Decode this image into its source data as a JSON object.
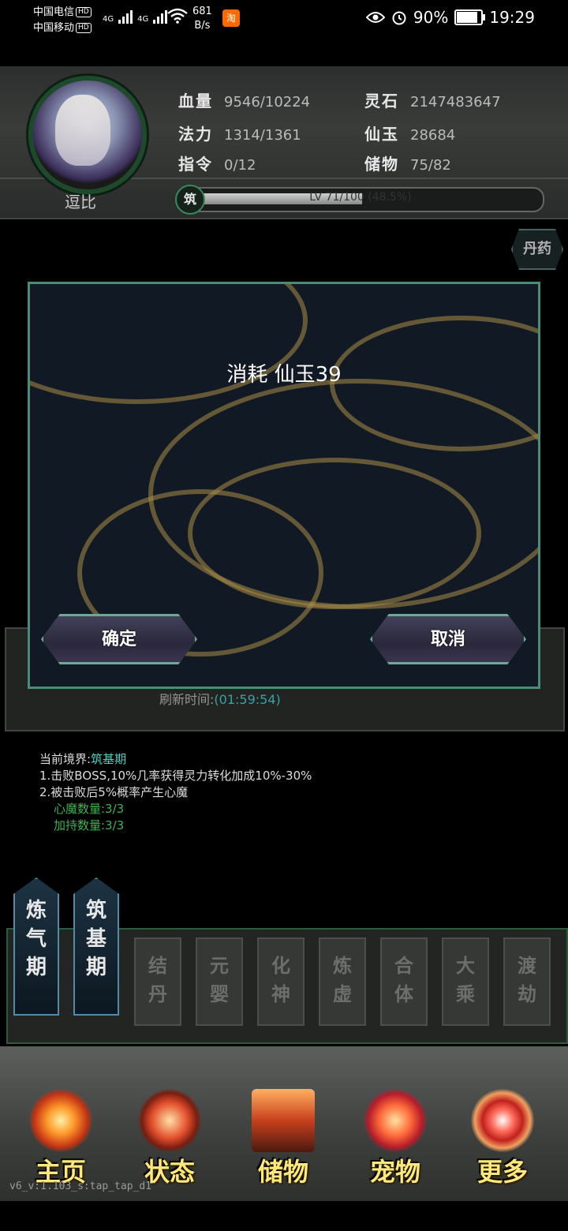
{
  "status_bar": {
    "carrier1": "中国电信",
    "carrier2": "中国移动",
    "hd": "HD",
    "net1": "4G",
    "net2": "4G",
    "speed_value": "681",
    "speed_unit": "B/s",
    "app_badge": "淘",
    "battery": "90%",
    "battery_level": 0.9,
    "time": "19:29"
  },
  "player": {
    "name": "逗比",
    "stats": [
      {
        "label": "血量",
        "value": "9546/10224"
      },
      {
        "label": "灵石",
        "value": "2147483647"
      },
      {
        "label": "法力",
        "value": "1314/1361"
      },
      {
        "label": "仙玉",
        "value": "28684"
      },
      {
        "label": "指令",
        "value": "0/12"
      },
      {
        "label": "储物",
        "value": "75/82"
      }
    ],
    "realm_badge": "筑",
    "level_text": "LV 71/100 (48.5%)",
    "level_fraction": 0.485
  },
  "side_button": "丹药",
  "background": {
    "refresh_label": "刷新时间:",
    "refresh_time": "(01:59:54)",
    "realm_label": "当前境界:",
    "realm_value": "筑基期",
    "line1": "1.击败BOSS,10%几率获得灵力转化加成10%-30%",
    "line2": "2.被击败后5%概率产生心魔",
    "line3": "心魔数量:3/3",
    "line4": "加持数量:3/3"
  },
  "realm_tabs": {
    "active": [
      "炼气期",
      "筑基期"
    ],
    "locked": [
      "结丹",
      "元婴",
      "化神",
      "炼虚",
      "合体",
      "大乘",
      "渡劫"
    ]
  },
  "nav": [
    {
      "label": "主页",
      "icon": "home-icon"
    },
    {
      "label": "状态",
      "icon": "status-icon"
    },
    {
      "label": "储物",
      "icon": "storage-icon"
    },
    {
      "label": "宠物",
      "icon": "pet-icon"
    },
    {
      "label": "更多",
      "icon": "more-icon"
    }
  ],
  "version": "v6_v:1.103_s:tap_tap_d1",
  "modal": {
    "message": "消耗  仙玉39",
    "confirm": "确定",
    "cancel": "取消"
  }
}
